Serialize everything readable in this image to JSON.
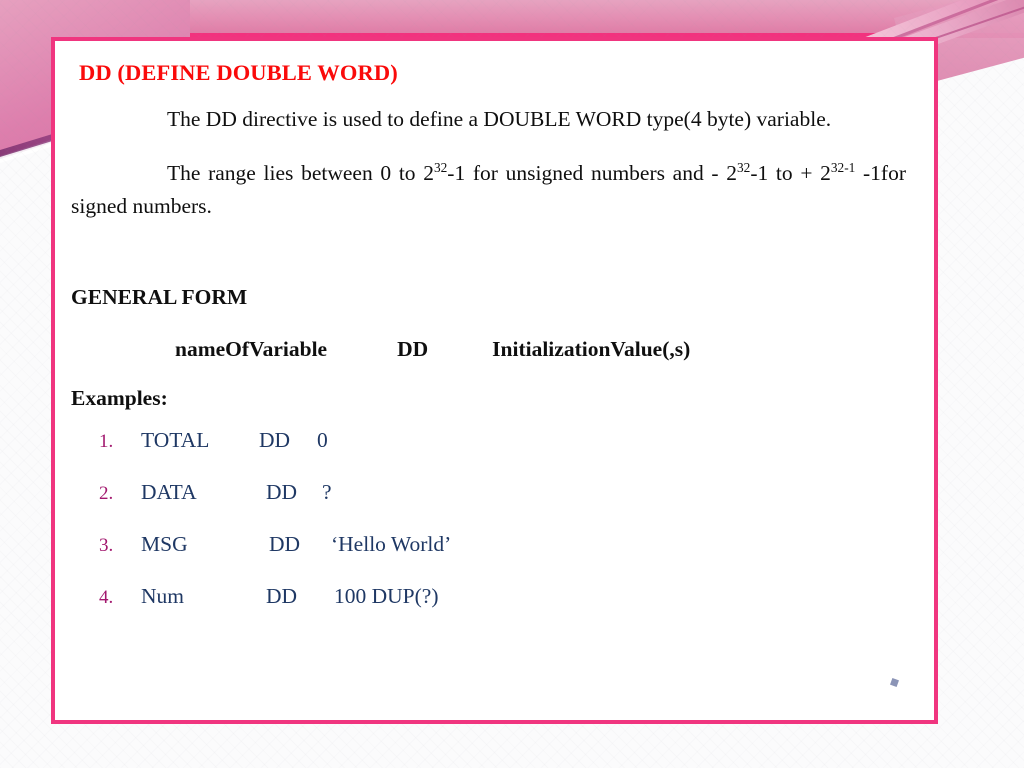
{
  "slide": {
    "title": "DD (DEFINE DOUBLE WORD)",
    "accent_border_color": "#f0357f",
    "title_color": "#fa0a0a",
    "band_color": "#e490b4",
    "list_text_color": "#1f3864",
    "list_number_color": "#a2186e"
  },
  "paragraphs": {
    "intro": {
      "lead": "The DD directive is used to define a DOUBLE WORD type(4 byte) variable."
    },
    "range": {
      "part1": "The range lies between 0 to 2",
      "sup1": "32",
      "part2": "-1 for unsigned numbers and - 2",
      "sup2": "32",
      "part3": "-1 to + 2",
      "sup3": "32-1",
      "part4": " -1for signed numbers."
    }
  },
  "general_form": {
    "heading": "GENERAL FORM",
    "name": "nameOfVariable",
    "directive": "DD",
    "value": "InitializationValue(,s)"
  },
  "examples": {
    "heading": "Examples:",
    "items": [
      {
        "num": "1.",
        "name": "TOTAL",
        "directive": "DD",
        "value": "0"
      },
      {
        "num": "2.",
        "name": "DATA",
        "directive": "DD",
        "value": "?"
      },
      {
        "num": "3.",
        "name": "MSG",
        "directive": "DD",
        "value": "‘Hello World’"
      },
      {
        "num": "4.",
        "name": "Num",
        "directive": "DD",
        "value": "100 DUP(?)"
      }
    ]
  }
}
